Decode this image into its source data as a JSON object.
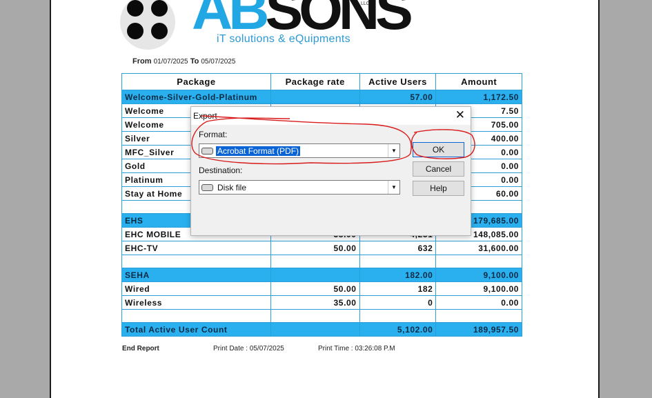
{
  "logo": {
    "brand_ab": "AB",
    "brand_sons": "SONS",
    "llc": "LLC",
    "tagline": "iT solutions & eQuipments"
  },
  "report": {
    "from_label": "From",
    "from_date": "01/07/2025",
    "to_label": "To",
    "to_date": "05/07/2025",
    "columns": [
      "Package",
      "Package rate",
      "Active Users",
      "Amount"
    ],
    "rows": [
      {
        "package": "Welcome-Silver-Gold-Platinum",
        "rate": "",
        "users": "57.00",
        "amount": "1,172.50",
        "highlight": true
      },
      {
        "package": "Welcome",
        "rate": "",
        "users": "",
        "amount": "7.50"
      },
      {
        "package": "Welcome",
        "rate": "",
        "users": "",
        "amount": "705.00"
      },
      {
        "package": "Silver",
        "rate": "",
        "users": "",
        "amount": "400.00"
      },
      {
        "package": "MFC_Silver",
        "rate": "",
        "users": "",
        "amount": "0.00"
      },
      {
        "package": "Gold",
        "rate": "",
        "users": "",
        "amount": "0.00"
      },
      {
        "package": "Platinum",
        "rate": "",
        "users": "",
        "amount": "0.00"
      },
      {
        "package": "Stay at Home",
        "rate": "",
        "users": "",
        "amount": "60.00"
      },
      {
        "package": "",
        "rate": "",
        "users": "",
        "amount": "",
        "blank": true
      },
      {
        "package": "EHS",
        "rate": "",
        "users": "",
        "amount": "179,685.00",
        "highlight": true
      },
      {
        "package": "EHC MOBILE",
        "rate": "35.00",
        "users": "4,231",
        "amount": "148,085.00"
      },
      {
        "package": "EHC-TV",
        "rate": "50.00",
        "users": "632",
        "amount": "31,600.00"
      },
      {
        "package": "",
        "rate": "",
        "users": "",
        "amount": "",
        "blank": true
      },
      {
        "package": "SEHA",
        "rate": "",
        "users": "182.00",
        "amount": "9,100.00",
        "highlight": true
      },
      {
        "package": "Wired",
        "rate": "50.00",
        "users": "182",
        "amount": "9,100.00"
      },
      {
        "package": "Wireless",
        "rate": "35.00",
        "users": "0",
        "amount": "0.00"
      },
      {
        "package": "",
        "rate": "",
        "users": "",
        "amount": "",
        "blank": true
      },
      {
        "package": "Total Active User Count",
        "rate": "",
        "users": "5,102.00",
        "amount": "189,957.50",
        "highlight": true
      }
    ],
    "footer": {
      "end": "End Report",
      "print_date": "Print Date : 05/07/2025",
      "print_time": "Print Time : 03:26:08 P.M"
    }
  },
  "dialog": {
    "title": "Export",
    "close_glyph": "✕",
    "format_label": "Format:",
    "format_value": "Acrobat Format (PDF)",
    "destination_label": "Destination:",
    "destination_value": "Disk file",
    "ok_label": "OK",
    "cancel_label": "Cancel",
    "help_label": "Help"
  },
  "annotation_color": "#d81b1b",
  "colors": {
    "highlight_row": "#2ab0ef",
    "border": "#2a9fd8",
    "brand_blue": "#22a7e5"
  }
}
